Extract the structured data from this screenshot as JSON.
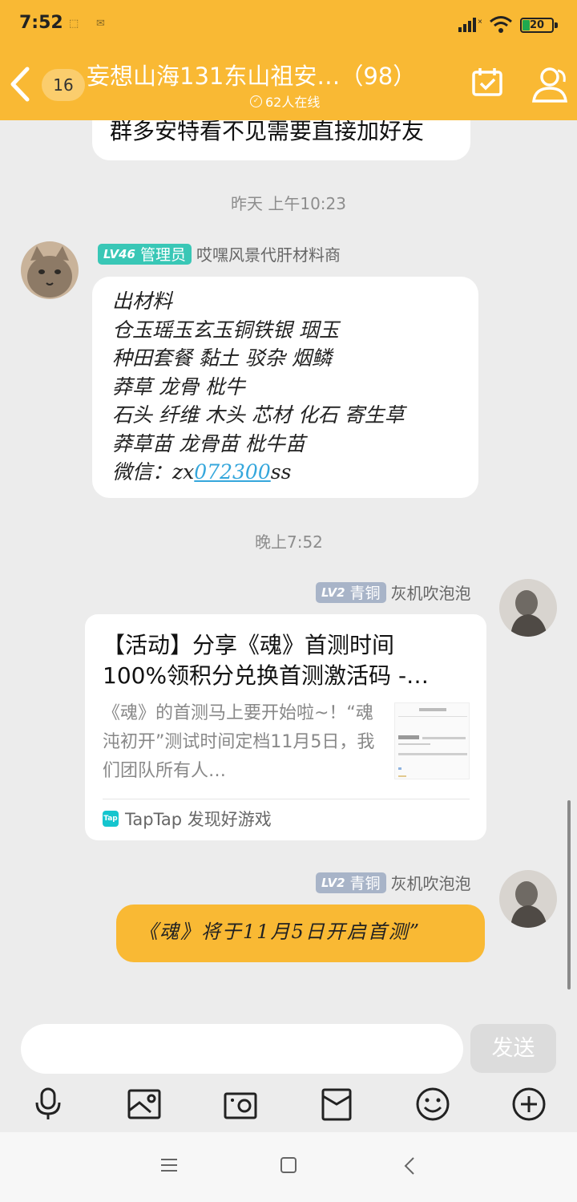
{
  "status_bar": {
    "time": "7:52",
    "battery": "20"
  },
  "header": {
    "unread_count": "16",
    "title": "妄想山海131东山祖安…（98）",
    "online": "62人在线"
  },
  "messages": {
    "prev_text": "群多安特看不见需要直接加好友",
    "ts1": "昨天 上午10:23",
    "msg1": {
      "level": "LV46",
      "role": "管理员",
      "name": "哎嘿风景代肝材料商",
      "lines": [
        "出材料",
        "仓玉瑶玉玄玉铜铁银 珚玉",
        "种田套餐 黏土 驳杂 烟鳞",
        "莽草 龙骨 枇牛",
        "石头 纤维 木头 芯材 化石 寄生草",
        "莽草苗 龙骨苗 枇牛苗"
      ],
      "wechat_label": "微信：",
      "wechat_prefix": "zx",
      "wechat_link": "072300",
      "wechat_suffix": "ss"
    },
    "ts2": "晚上7:52",
    "msg2": {
      "level": "LV2",
      "role": "青铜",
      "name": "灰机吹泡泡",
      "card_title": "【活动】分享《魂》首测时间100%领积分兑换首测激活码 -…",
      "card_desc": "《魂》的首测马上要开始啦~！“魂沌初开”测试时间定档11月5日，我们团队所有人…",
      "card_source": "TapTap 发现好游戏",
      "tap_logo": "Tap"
    },
    "msg3": {
      "level": "LV2",
      "role": "青铜",
      "name": "灰机吹泡泡",
      "text": "《魂》将于11月5日开启首测”"
    }
  },
  "input": {
    "placeholder": "",
    "send_label": "发送"
  },
  "colors": {
    "header": "#f9b934",
    "own_bubble": "#f9b934",
    "admin_badge": "#39c7b6",
    "bronze_badge": "#a8b4c8",
    "link": "#35a7dc"
  },
  "icons": [
    "back-icon",
    "calendar-check-icon",
    "group-members-icon",
    "mic-icon",
    "image-icon",
    "camera-icon",
    "red-packet-icon",
    "emoji-icon",
    "plus-icon"
  ]
}
